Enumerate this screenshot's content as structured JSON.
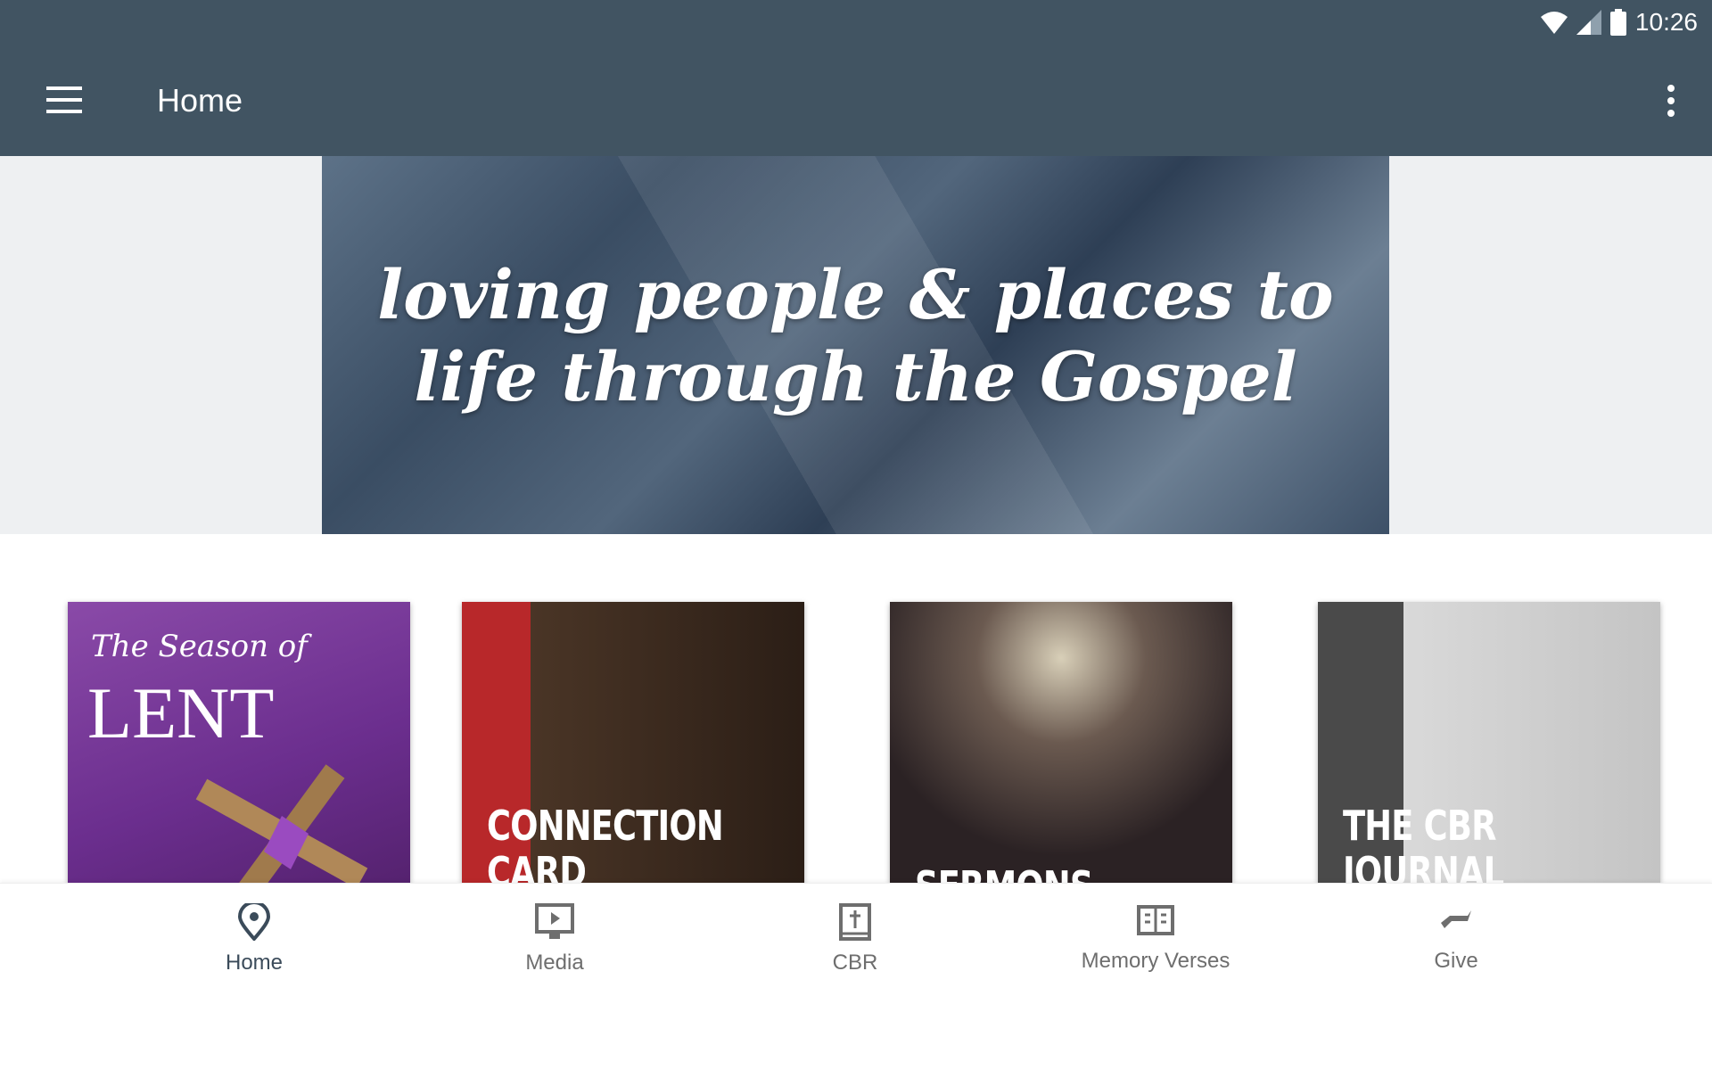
{
  "status_bar": {
    "time": "10:26",
    "icons": [
      "wifi-icon",
      "signal-icon",
      "battery-icon"
    ]
  },
  "app_bar": {
    "title": "Home",
    "menu_icon": "hamburger-menu-icon",
    "more_icon": "more-vertical-icon"
  },
  "hero": {
    "text_line1": "loving people & places to",
    "text_line2": "life through the Gospel"
  },
  "cards": [
    {
      "label": "",
      "logo_small": "The Season of",
      "logo_big": "LENT"
    },
    {
      "label": "CONNECTION CARD"
    },
    {
      "label": "SERMONS"
    },
    {
      "label": "THE CBR JOURNAL"
    }
  ],
  "bottom_nav": [
    {
      "label": "Home",
      "icon": "location-pin-icon",
      "active": true
    },
    {
      "label": "Media",
      "icon": "video-play-icon"
    },
    {
      "label": "CBR",
      "icon": "bible-icon"
    },
    {
      "label": "Memory Verses",
      "icon": "open-book-icon"
    },
    {
      "label": "Give",
      "icon": "giving-hand-icon"
    }
  ],
  "colors": {
    "app_bar": "#415462",
    "active_nav": "#3b4b5a",
    "inactive_nav": "#6e6e6e"
  }
}
